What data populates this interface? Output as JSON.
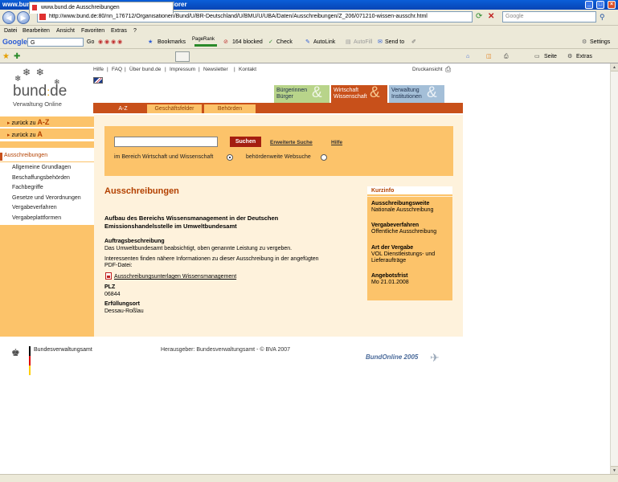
{
  "window": {
    "title": "www.bund.de Ausschreibungen - Windows Internet Explorer",
    "url": "http://www.bund.de:80/nn_176712/Organisationen/Bund/U/BR-Deutschland/U/BMU/U/UBA/Daten/Ausschreibungen/Z_206/071210-wissen-ausschr.html",
    "search_placeholder": "Google"
  },
  "menu": [
    "Datei",
    "Bearbeiten",
    "Ansicht",
    "Favoriten",
    "Extras",
    "?"
  ],
  "googlebar": {
    "brand": "Google",
    "input": "G",
    "go": "Go",
    "bookmarks": "Bookmarks",
    "pagerank": "PageRank",
    "blocked": "164 blocked",
    "check": "Check",
    "autolink": "AutoLink",
    "autofill": "AutoFill",
    "sendto": "Send to",
    "settings": "Settings"
  },
  "tabbar": {
    "tab_label": "www.bund.de Ausschreibungen",
    "seite": "Seite",
    "extras": "Extras"
  },
  "page": {
    "logo_main": "bund",
    "logo_de": "de",
    "logo_sub": "Verwaltung Online",
    "toplinks": [
      "Hilfe",
      "FAQ",
      "Über bund.de",
      "Impressum",
      "Newsletter",
      "Kontakt"
    ],
    "druckansicht": "Druckansicht",
    "audience_tabs": [
      {
        "line1": "Bürgerinnen",
        "line2": "Bürger"
      },
      {
        "line1": "Wirtschaft",
        "line2": "Wissenschaft"
      },
      {
        "line1": "Verwaltung",
        "line2": "Institutionen"
      }
    ],
    "subtabs": [
      "A-Z",
      "Geschäftsfelder",
      "Behörden"
    ],
    "back_az_prefix": "zurück zu",
    "back_az": "A-Z",
    "back_a_prefix": "zurück zu",
    "back_a": "A",
    "section": "Ausschreibungen",
    "left_links": [
      "Allgemeine Grundlagen",
      "Beschaffungsbehörden",
      "Fachbegriffe",
      "Gesetze und Verordnungen",
      "Vergabeverfahren",
      "Vergabeplattformen"
    ],
    "search": {
      "button": "Suchen",
      "advanced": "Erweiterte Suche",
      "help": "Hilfe",
      "radio1": "im Bereich Wirtschaft und Wissenschaft",
      "radio2": "behördenweite Websuche"
    },
    "heading": "Ausschreibungen",
    "subheading_line1": "Aufbau des Bereichs Wissensmanagement in der Deutschen",
    "subheading_line2": "Emissionshandelsstelle im Umweltbundesamt",
    "auftrag_label": "Auftragsbeschreibung",
    "auftrag_text": "Das Umweltbundesamt beabsichtigt, oben genannte Leistung zu vergeben.",
    "interest_line1": "Interessenten finden nähere Informationen zu dieser Ausschreibung in der angefügten",
    "interest_line2": "PDF-Datei:",
    "pdf_link": "Ausschreibungsunterlagen Wissensmanagement",
    "plz_label": "PLZ",
    "plz": "06844",
    "ort_label": "Erfüllungsort",
    "ort": "Dessau-Roßlau",
    "kurzinfo": {
      "title": "Kurzinfo",
      "items": [
        {
          "label": "Ausschreibungsweite",
          "value": "Nationale Ausschreibung"
        },
        {
          "label": "Vergabeverfahren",
          "value": "Öffentliche Ausschreibung"
        },
        {
          "label": "Art der Vergabe",
          "value": "VOL Dienstleistungs- und",
          "value2": "Lieferaufträge"
        },
        {
          "label": "Angebotsfrist",
          "value": "Mo 21.01.2008"
        }
      ]
    },
    "footer_agency": "Bundesverwaltungsamt",
    "footer_publisher": "Herausgeber: Bundesverwaltungsamt - © BVA 2007",
    "footer_bundonline": "BundOnline 2005"
  }
}
